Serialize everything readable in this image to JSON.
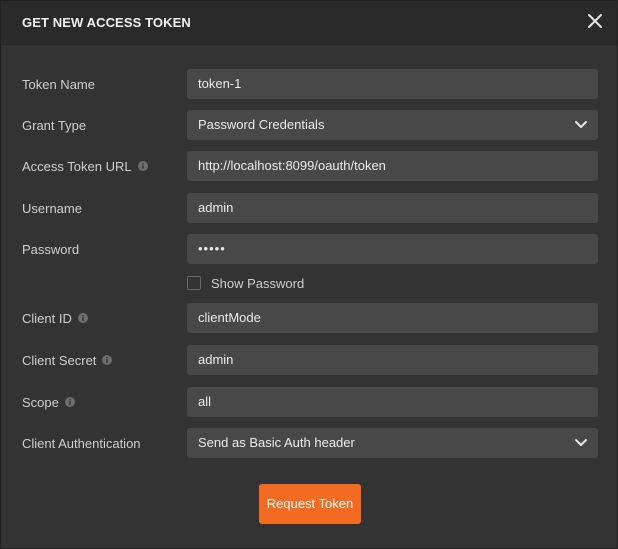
{
  "dialog": {
    "title": "GET NEW ACCESS TOKEN",
    "close_icon": "close-icon"
  },
  "form": {
    "token_name": {
      "label": "Token Name",
      "value": "token-1"
    },
    "grant_type": {
      "label": "Grant Type",
      "value": "Password Credentials"
    },
    "access_token_url": {
      "label": "Access Token URL",
      "value": "http://localhost:8099/oauth/token"
    },
    "username": {
      "label": "Username",
      "value": "admin"
    },
    "password": {
      "label": "Password",
      "value": "•••••"
    },
    "show_password": {
      "label": "Show Password",
      "checked": false
    },
    "client_id": {
      "label": "Client ID",
      "value": "clientMode"
    },
    "client_secret": {
      "label": "Client Secret",
      "value": "admin"
    },
    "scope": {
      "label": "Scope",
      "value": "all"
    },
    "client_authentication": {
      "label": "Client Authentication",
      "value": "Send as Basic Auth header"
    }
  },
  "actions": {
    "request_token_label": "Request Token"
  },
  "colors": {
    "accent": "#f26b21",
    "background": "#333333",
    "field": "#484848"
  }
}
